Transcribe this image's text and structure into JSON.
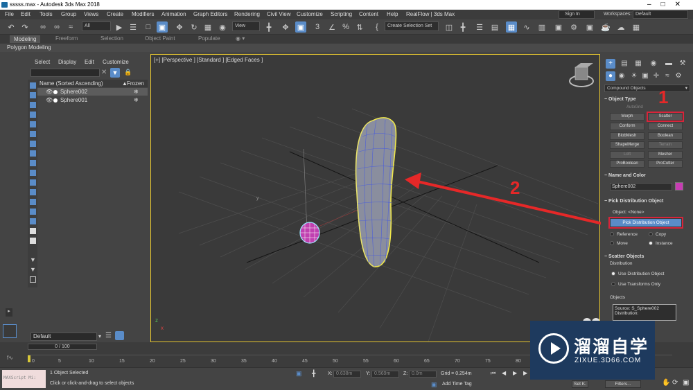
{
  "window": {
    "title": "sssss.max - Autodesk 3ds Max 2018"
  },
  "menu": {
    "items": [
      "File",
      "Edit",
      "Tools",
      "Group",
      "Views",
      "Create",
      "Modifiers",
      "Animation",
      "Graph Editors",
      "Rendering",
      "Civil View",
      "Customize",
      "Scripting",
      "Content",
      "Help",
      "RealFlow | 3ds Max"
    ],
    "sign_in": "Sign In",
    "workspaces_label": "Workspaces:",
    "workspace": "Default"
  },
  "toolbar": {
    "filter": "All",
    "view": "View",
    "selection_set": "Create Selection Set"
  },
  "ribbon": {
    "tabs": [
      "Modeling",
      "Freeform",
      "Selection",
      "Object Paint",
      "Populate"
    ],
    "active": "Modeling",
    "sub_label": "Polygon Modeling"
  },
  "scene_explorer": {
    "tabs": [
      "Select",
      "Display",
      "Edit",
      "Customize"
    ],
    "column_name": "Name (Sorted Ascending)",
    "column_frozen": "Frozen",
    "rows": [
      {
        "name": "Sphere002",
        "selected": true
      },
      {
        "name": "Sphere001",
        "selected": false
      }
    ],
    "layer": "Default"
  },
  "viewport": {
    "label": "[+] [Perspective ] [Standard ] [Edged Faces ]",
    "axis_x": "x",
    "axis_y": "y",
    "axis_z": "z"
  },
  "command_panel": {
    "category": "Compound Objects",
    "object_type": {
      "title": "Object Type",
      "autogrid": "AutoGrid",
      "buttons": [
        "Morph",
        "Scatter",
        "Conform",
        "Connect",
        "BlobMesh",
        "Boolean",
        "ShapeMerge",
        "Terrain",
        "Loft",
        "Mesher",
        "ProBoolean",
        "ProCutter"
      ],
      "disabled": [
        "Terrain",
        "Loft"
      ]
    },
    "name_color": {
      "title": "Name and Color",
      "name": "Sphere002",
      "color": "#c83cb4"
    },
    "pick_dist": {
      "title": "Pick Distribution Object",
      "object_label": "Object: <None>",
      "pick_button": "Pick Distribution Object",
      "reference": "Reference",
      "copy": "Copy",
      "move": "Move",
      "instance": "Instance"
    },
    "scatter_objects": {
      "title": "Scatter Objects",
      "distribution": "Distribution",
      "use_dist": "Use Distribution Object",
      "use_transforms": "Use Transforms Only",
      "objects": "Objects",
      "source": "Source: S_Sphere002",
      "distrib": "Distribution:"
    }
  },
  "annotations": {
    "one": "1",
    "two": "2",
    "color": "#e62828"
  },
  "timeline": {
    "slider": "0 / 100",
    "ticks": [
      "0",
      "5",
      "10",
      "15",
      "20",
      "25",
      "30",
      "35",
      "40",
      "45",
      "50",
      "55",
      "60",
      "65",
      "70",
      "75",
      "80",
      "85",
      "90",
      "95",
      "100"
    ]
  },
  "status": {
    "script_label": "MAXScript Mi:",
    "selected": "1 Object Selected",
    "hint": "Click or click-and-drag to select objects",
    "x_label": "X:",
    "x": "0.638m",
    "y_label": "Y:",
    "y": "0.569m",
    "z_label": "Z:",
    "z": "0.0m",
    "grid": "Grid = 0.254m",
    "add_time_tag": "Add Time Tag",
    "set_key": "Set K.",
    "filters": "Filters..."
  },
  "watermark": {
    "brand_cn": "溜溜自学",
    "brand_en": "ZIXUE.3D66.COM"
  }
}
